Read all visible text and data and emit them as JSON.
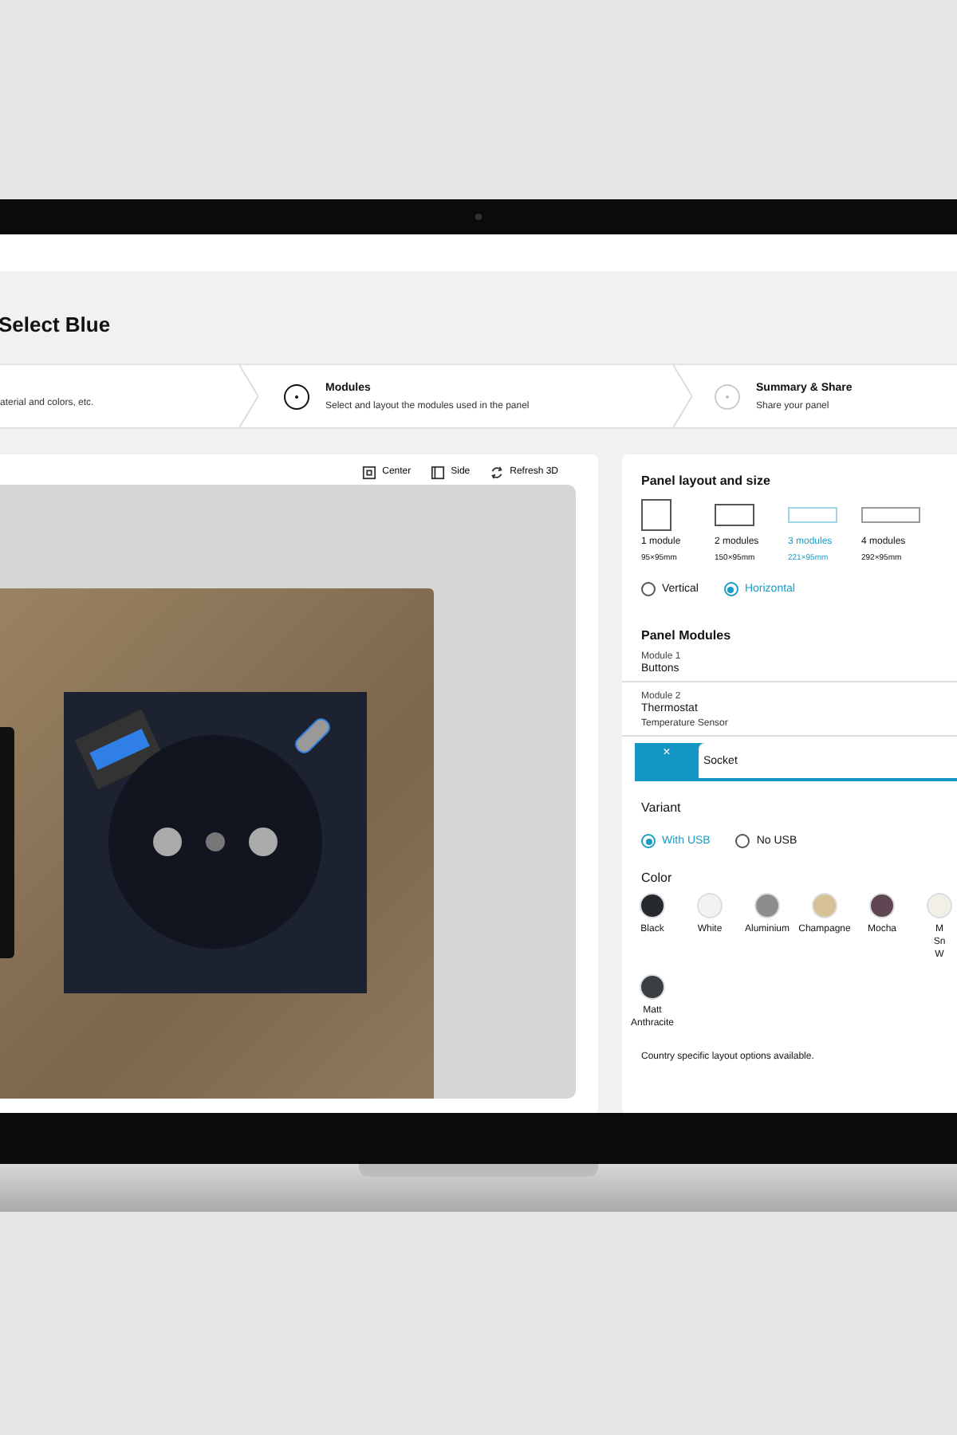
{
  "page_title": "Select Blue",
  "steps": [
    {
      "description": "aterial and colors, etc."
    },
    {
      "title": "Modules",
      "description": "Select and layout the modules used in the panel",
      "selected": true
    },
    {
      "title": "Summary & Share",
      "description": "Share your panel",
      "selected": false
    }
  ],
  "view_buttons": [
    {
      "kind": "center",
      "label": "Center"
    },
    {
      "kind": "side",
      "label": "Side"
    },
    {
      "kind": "refresh",
      "label": "Refresh 3D"
    }
  ],
  "layout": {
    "heading": "Panel layout and size",
    "options": [
      {
        "label": "1 module",
        "size": "95×95mm",
        "selected": false
      },
      {
        "label": "2 modules",
        "size": "150×95mm",
        "selected": false
      },
      {
        "label": "3 modules",
        "size": "221×95mm",
        "selected": true
      },
      {
        "label": "4 modules",
        "size": "292×95mm",
        "selected": false
      }
    ],
    "orientation": [
      {
        "label": "Vertical",
        "selected": false
      },
      {
        "label": "Horizontal",
        "selected": true
      }
    ]
  },
  "modules": {
    "heading": "Panel Modules",
    "items": [
      {
        "index": "Module 1",
        "name": "Buttons"
      },
      {
        "index": "Module 2",
        "name": "Thermostat",
        "detail": "Temperature Sensor"
      }
    ],
    "editing": {
      "close": "×",
      "value": "Socket"
    }
  },
  "variant": {
    "heading": "Variant",
    "options": [
      {
        "label": "With USB",
        "selected": true
      },
      {
        "label": "No USB",
        "selected": false
      }
    ]
  },
  "color": {
    "heading": "Color",
    "swatches": [
      {
        "lines": [
          "Black"
        ],
        "color": "#26292e"
      },
      {
        "lines": [
          "White"
        ],
        "color": "#f2f3f1"
      },
      {
        "lines": [
          "Aluminium"
        ],
        "color": "#8d8d8d"
      },
      {
        "lines": [
          "Champagne"
        ],
        "color": "#d6c196"
      },
      {
        "lines": [
          "Mocha"
        ],
        "color": "#5f4652"
      },
      {
        "lines": [
          "M",
          "Sn",
          "W"
        ],
        "color": "#f2f0e6"
      },
      {
        "lines": [
          "Matt",
          "Anthracite"
        ],
        "color": "#3a3f43"
      }
    ]
  },
  "note": "Country specific layout options available."
}
